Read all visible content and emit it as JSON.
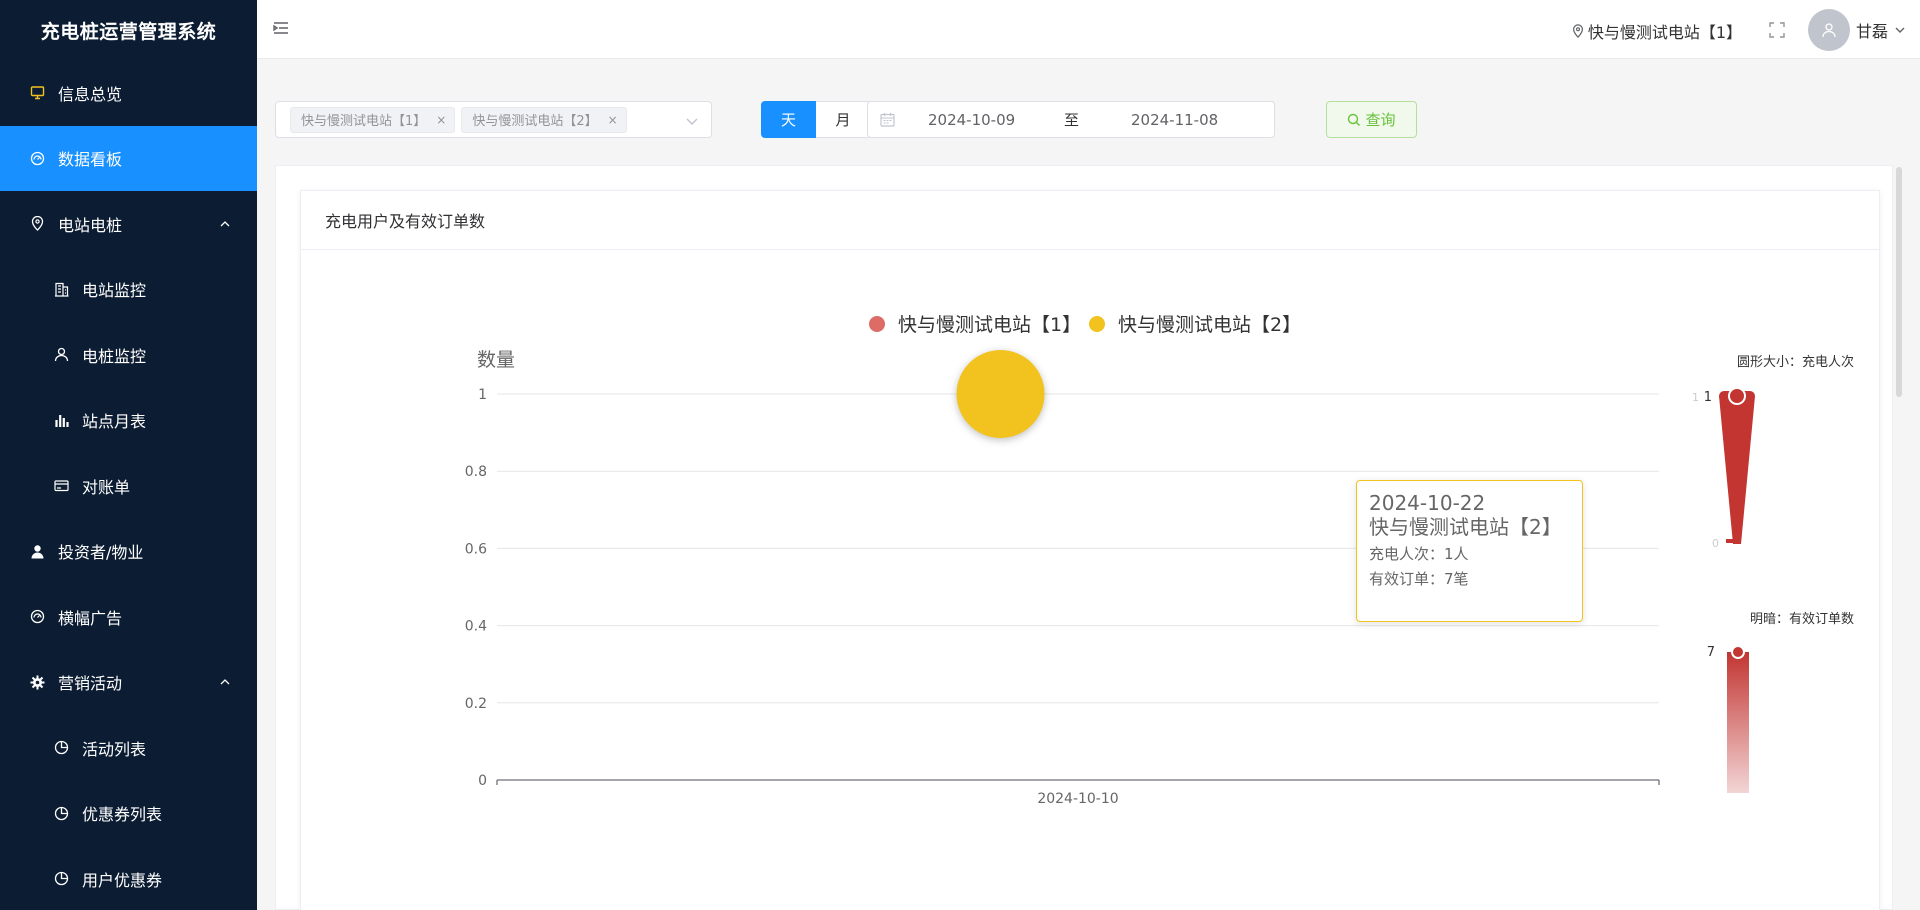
{
  "sidebar": {
    "brand": "充电桩运营管理系统",
    "items": [
      {
        "label": "信息总览",
        "icon": "monitor-icon",
        "level": 0,
        "active": false
      },
      {
        "label": "数据看板",
        "icon": "dashboard-icon",
        "level": 0,
        "active": true
      },
      {
        "label": "电站电桩",
        "icon": "location-icon",
        "level": 0,
        "active": false,
        "expanded": true
      },
      {
        "label": "电站监控",
        "icon": "building-icon",
        "level": 1,
        "active": false
      },
      {
        "label": "电桩监控",
        "icon": "user-outline-icon",
        "level": 1,
        "active": false
      },
      {
        "label": "站点月表",
        "icon": "bar-chart-icon",
        "level": 1,
        "active": false
      },
      {
        "label": "对账单",
        "icon": "card-icon",
        "level": 1,
        "active": false
      },
      {
        "label": "投资者/物业",
        "icon": "user-solid-icon",
        "level": 0,
        "active": false
      },
      {
        "label": "横幅广告",
        "icon": "dashboard-icon",
        "level": 0,
        "active": false
      },
      {
        "label": "营销活动",
        "icon": "gear-icon",
        "level": 0,
        "active": false,
        "expanded": true
      },
      {
        "label": "活动列表",
        "icon": "pie-icon",
        "level": 1,
        "active": false
      },
      {
        "label": "优惠券列表",
        "icon": "pie-icon",
        "level": 1,
        "active": false
      },
      {
        "label": "用户优惠券",
        "icon": "pie-icon",
        "level": 1,
        "active": false
      }
    ]
  },
  "header": {
    "station": "快与慢测试电站【1】",
    "username": "甘磊"
  },
  "filters": {
    "tags": [
      "快与慢测试电站【1】",
      "快与慢测试电站【2】"
    ],
    "tag_close": "×",
    "day_label": "天",
    "month_label": "月",
    "date_start": "2024-10-09",
    "date_sep": "至",
    "date_end": "2024-11-08",
    "query_label": "查询"
  },
  "card": {
    "title": "充电用户及有效订单数"
  },
  "chart_data": {
    "type": "scatter",
    "ylabel": "数量",
    "ylim": [
      0,
      1
    ],
    "yticks": [
      "0",
      "0.2",
      "0.4",
      "0.6",
      "0.8",
      "1"
    ],
    "xticks": [
      "2024-10-10"
    ],
    "series": [
      {
        "name": "快与慢测试电站【1】",
        "color": "#dd6b66",
        "points": []
      },
      {
        "name": "快与慢测试电站【2】",
        "color": "#f2c31e",
        "points": [
          {
            "x": "2024-10-22",
            "y": 1,
            "size": 1,
            "orders": 7
          }
        ]
      }
    ],
    "visual_map_size": {
      "title": "圆形大小：充电人次",
      "max_label": "1",
      "min_label": "0",
      "max_value_label": "1"
    },
    "visual_map_color": {
      "title": "明暗：有效订单数",
      "max_value_label": "7"
    }
  },
  "tooltip": {
    "date": "2024-10-22",
    "station": "快与慢测试电站【2】",
    "users_line": "充电人次：1人",
    "orders_line": "有效订单：7笔"
  },
  "colors": {
    "sidebar_bg": "#0c1d33",
    "accent": "#1890ff",
    "success": "#67c23a",
    "series1": "#dd6b66",
    "series2": "#f2c31e",
    "visual_red": "#c23531"
  }
}
